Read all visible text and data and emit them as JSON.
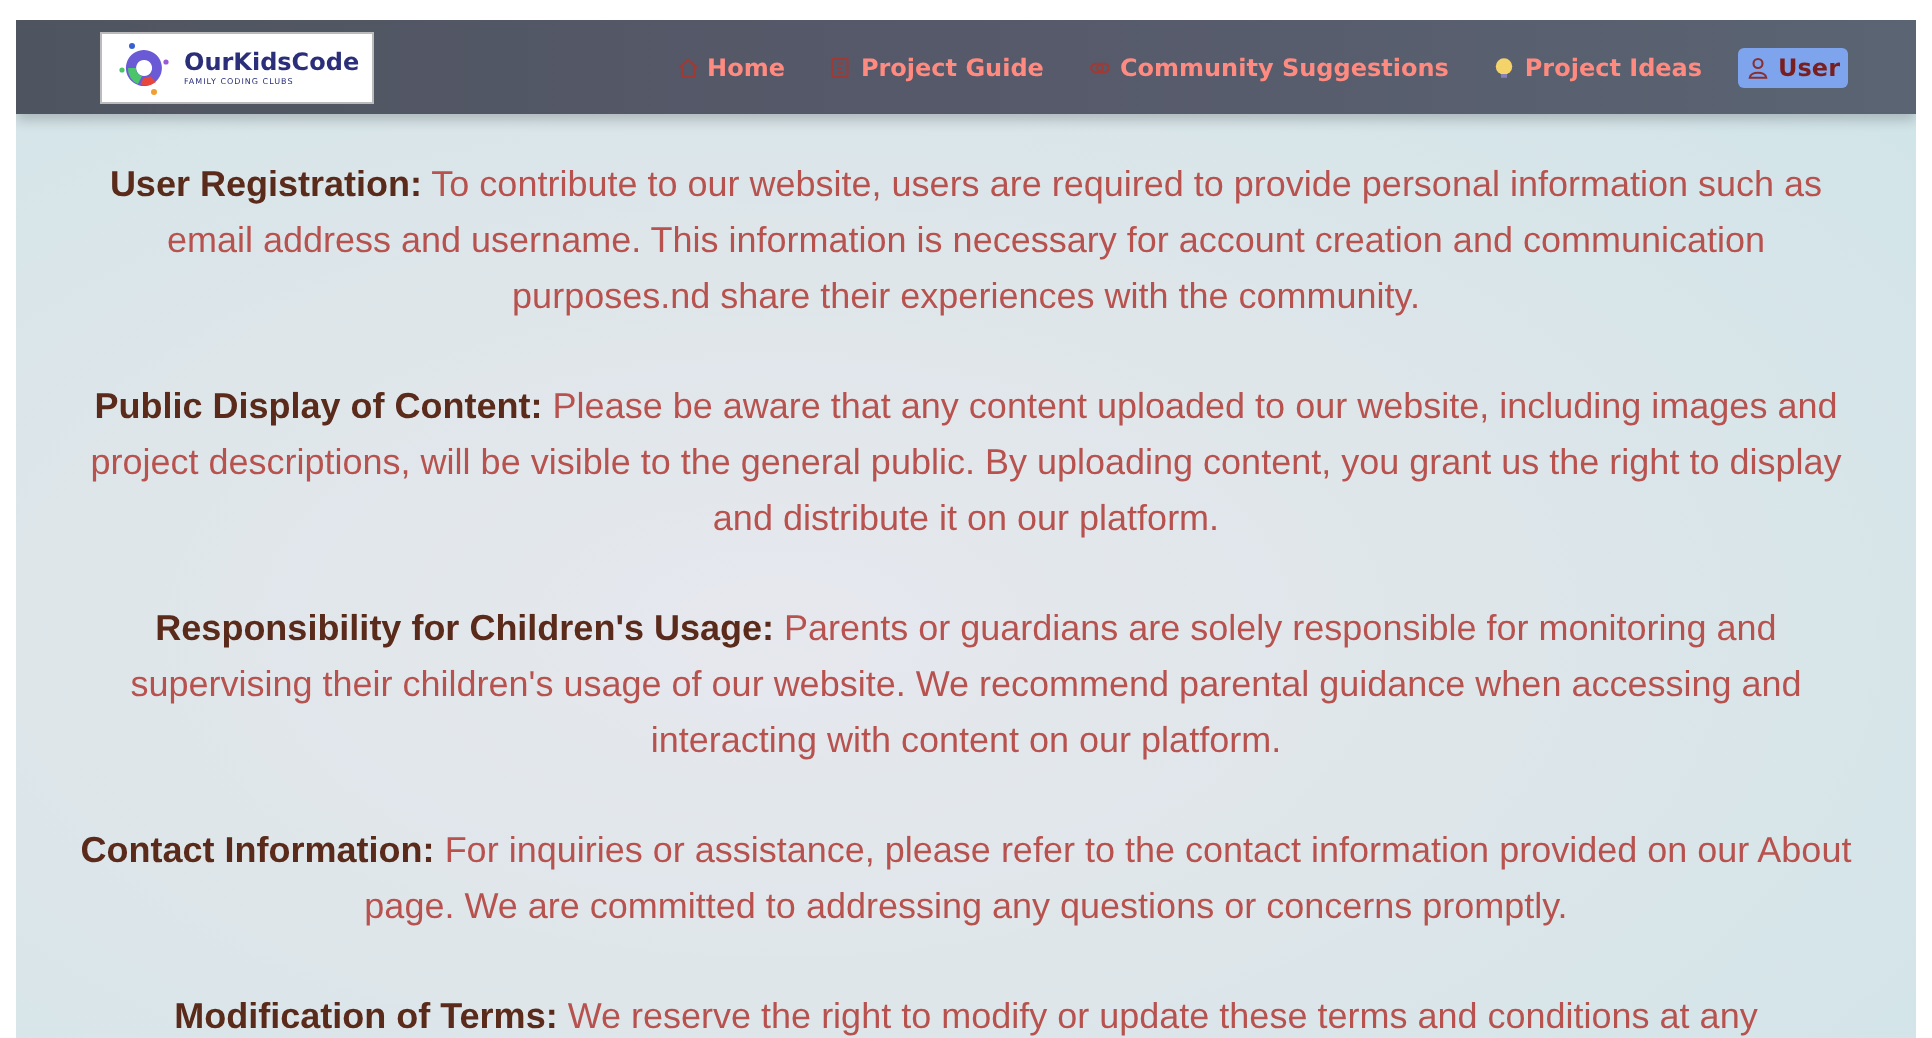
{
  "header": {
    "logo": {
      "name": "OurKidsCode",
      "tagline": "FAMILY CODING CLUBS"
    },
    "nav": [
      {
        "label": "Home",
        "kind": "home",
        "selected": false
      },
      {
        "label": "Project Guide",
        "kind": "guide",
        "selected": false
      },
      {
        "label": "Community Suggestions",
        "kind": "links",
        "selected": false
      },
      {
        "label": "Project Ideas",
        "kind": "bulb",
        "selected": false
      },
      {
        "label": "User",
        "kind": "user",
        "selected": true
      }
    ]
  },
  "terms": [
    {
      "heading": "User Registration:",
      "text": "To contribute to our website, users are required to provide personal information such as email address and username. This information is necessary for account creation and communication purposes.nd share their experiences with the community."
    },
    {
      "heading": "Public Display of Content:",
      "text": "Please be aware that any content uploaded to our website, including images and project descriptions, will be visible to the general public. By uploading content, you grant us the right to display and distribute it on our platform."
    },
    {
      "heading": "Responsibility for Children's Usage:",
      "text": "Parents or guardians are solely responsible for monitoring and supervising their children's usage of our website. We recommend parental guidance when accessing and interacting with content on our platform."
    },
    {
      "heading": "Contact Information:",
      "text": "For inquiries or assistance, please refer to the contact information provided on our About page. We are committed to addressing any questions or concerns promptly."
    },
    {
      "heading": "Modification of Terms:",
      "text": "We reserve the right to modify or update these terms and conditions at any"
    }
  ]
}
